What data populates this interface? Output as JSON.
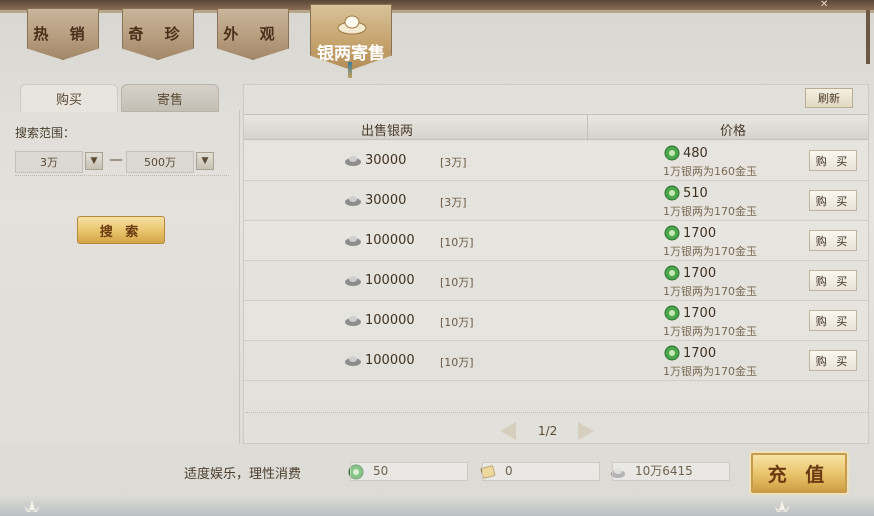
{
  "top_tabs": [
    {
      "label": "热 销"
    },
    {
      "label": "奇 珍"
    },
    {
      "label": "外 观"
    },
    {
      "label": "银两寄售"
    }
  ],
  "sub_tabs": {
    "buy": "购买",
    "sell": "寄售"
  },
  "search": {
    "label": "搜索范围：",
    "min": "3万",
    "max": "500万",
    "dash": "—",
    "button": "搜 索"
  },
  "refresh_label": "刷新",
  "table": {
    "headers": {
      "amount": "出售银两",
      "price": "价格"
    },
    "rows": [
      {
        "amount": "30000",
        "unit": "[3万]",
        "price": "480",
        "rate": "1万银两为160金玉",
        "buy": "购 买"
      },
      {
        "amount": "30000",
        "unit": "[3万]",
        "price": "510",
        "rate": "1万银两为170金玉",
        "buy": "购 买"
      },
      {
        "amount": "100000",
        "unit": "[10万]",
        "price": "1700",
        "rate": "1万银两为170金玉",
        "buy": "购 买"
      },
      {
        "amount": "100000",
        "unit": "[10万]",
        "price": "1700",
        "rate": "1万银两为170金玉",
        "buy": "购 买"
      },
      {
        "amount": "100000",
        "unit": "[10万]",
        "price": "1700",
        "rate": "1万银两为170金玉",
        "buy": "购 买"
      },
      {
        "amount": "100000",
        "unit": "[10万]",
        "price": "1700",
        "rate": "1万银两为170金玉",
        "buy": "购 买"
      }
    ]
  },
  "pagination": {
    "label": "1/2"
  },
  "footer": {
    "slogan": "适度娱乐，理性消费",
    "jade": "50",
    "ticket": "0",
    "silver": "10万6415",
    "recharge": "充 值"
  }
}
